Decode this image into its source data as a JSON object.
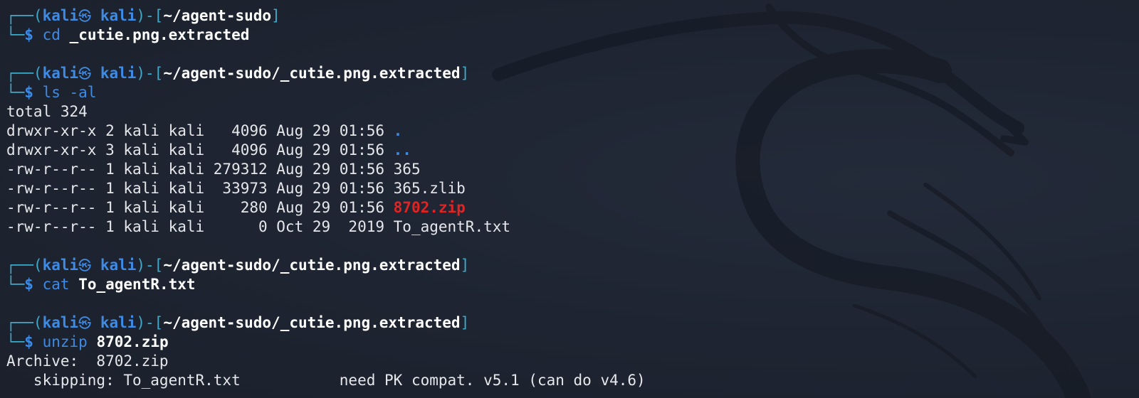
{
  "theme": {
    "background": "#1e2431",
    "prompt_frame": "#3fa9c9",
    "prompt_user": "#3d8be5",
    "archive_color": "#e02424",
    "text": "#e6e7ea"
  },
  "background_logo": "kali-dragon-icon",
  "prompt": {
    "frame_top_open": "┌──(",
    "user": "kali",
    "at_symbol": "㉿",
    "host": "kali",
    "frame_mid": ")-[",
    "frame_close": "]",
    "frame_bottom": "└─",
    "dollar": "$"
  },
  "blocks": [
    {
      "cwd": "~/agent-sudo",
      "command": "cd",
      "args": "_cutie.png.extracted"
    },
    {
      "cwd": "~/agent-sudo/_cutie.png.extracted",
      "command": "ls -al",
      "args": "",
      "output": {
        "total": "total 324",
        "entries": [
          {
            "meta": "drwxr-xr-x 2 kali kali   4096 Aug 29 01:56 ",
            "name": "."
          },
          {
            "meta": "drwxr-xr-x 3 kali kali   4096 Aug 29 01:56 ",
            "name": ".."
          },
          {
            "meta": "-rw-r--r-- 1 kali kali 279312 Aug 29 01:56 ",
            "name": "365"
          },
          {
            "meta": "-rw-r--r-- 1 kali kali  33973 Aug 29 01:56 ",
            "name": "365.zlib"
          },
          {
            "meta": "-rw-r--r-- 1 kali kali    280 Aug 29 01:56 ",
            "name": "8702.zip"
          },
          {
            "meta": "-rw-r--r-- 1 kali kali      0 Oct 29  2019 ",
            "name": "To_agentR.txt"
          }
        ]
      }
    },
    {
      "cwd": "~/agent-sudo/_cutie.png.extracted",
      "command": "cat",
      "args": "To_agentR.txt"
    },
    {
      "cwd": "~/agent-sudo/_cutie.png.extracted",
      "command": "unzip",
      "args": "8702.zip",
      "output": {
        "lines": [
          "Archive:  8702.zip",
          "   skipping: To_agentR.txt           need PK compat. v5.1 (can do v4.6)"
        ]
      }
    }
  ]
}
